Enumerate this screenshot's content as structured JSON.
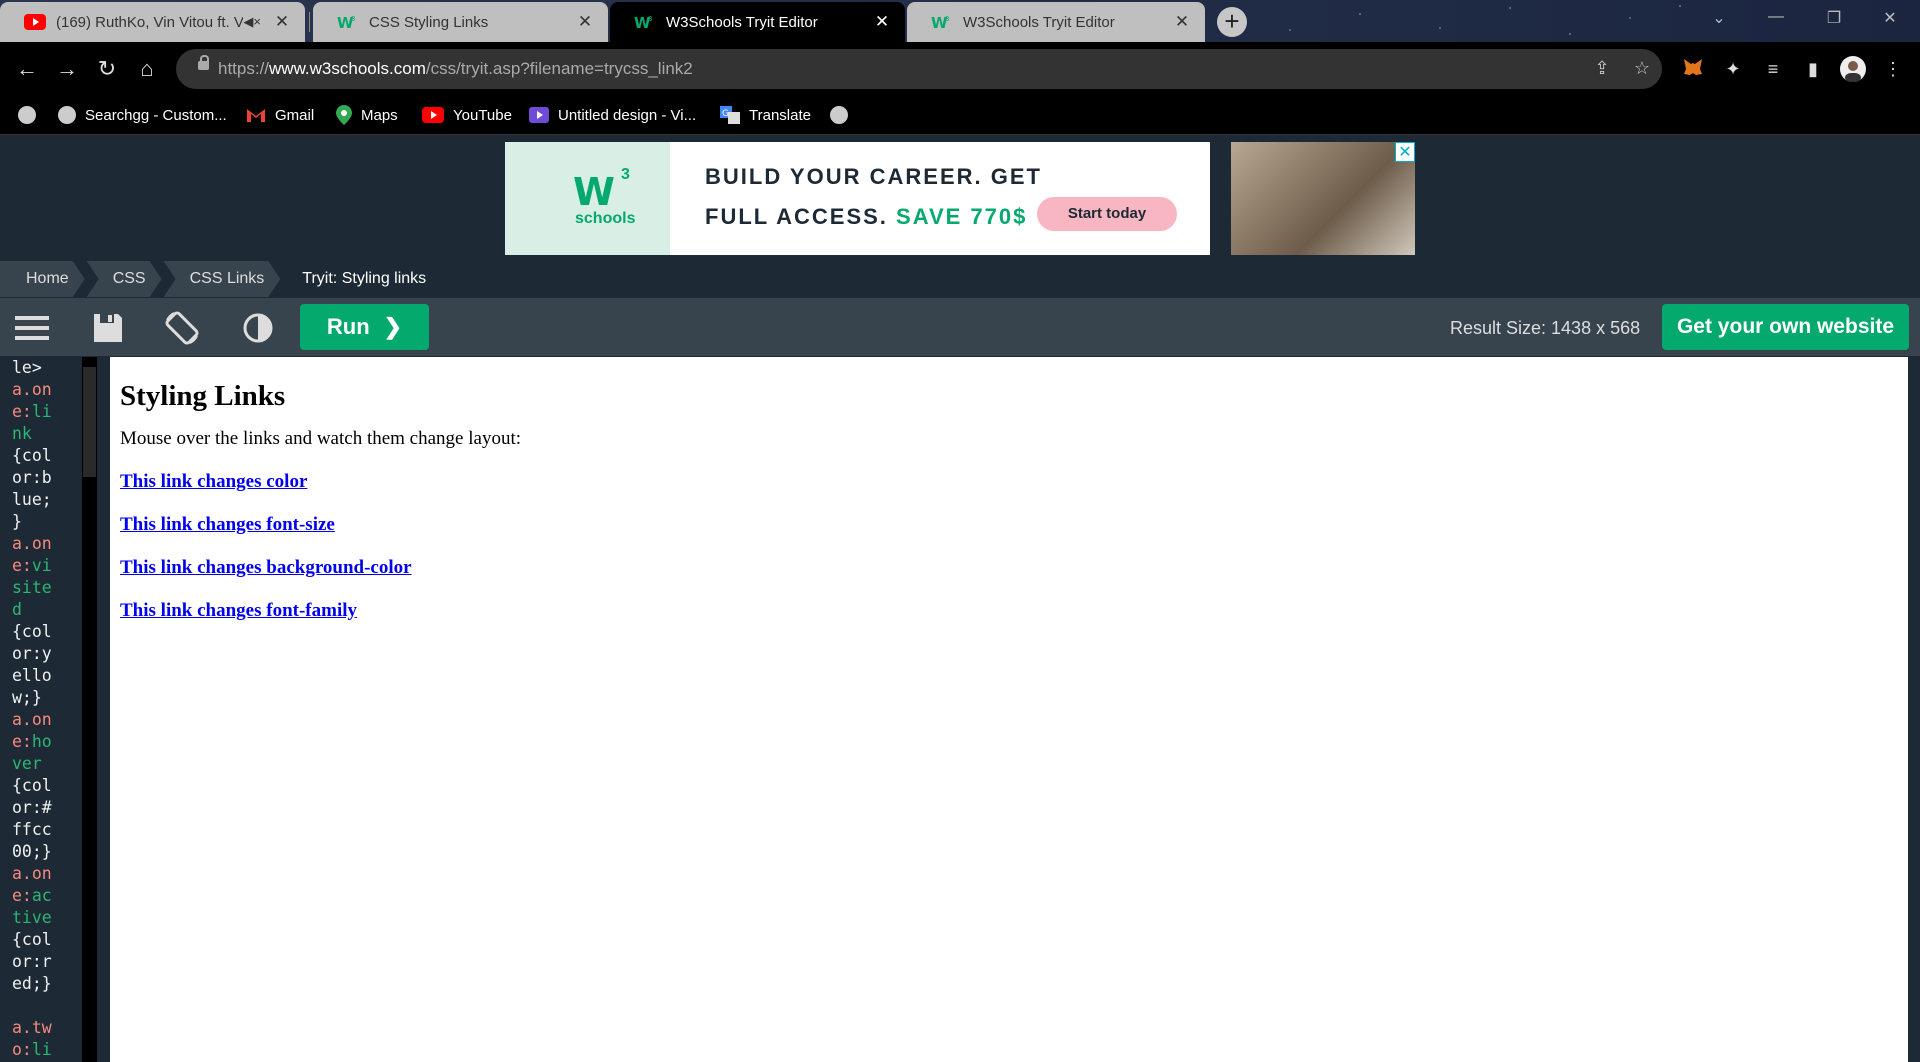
{
  "browser": {
    "tabs": [
      {
        "title": "(169) RuthKo, Vin Vitou ft. V",
        "favicon": "youtube-icon",
        "muted": true,
        "active": false
      },
      {
        "title": "CSS Styling Links",
        "favicon": "w3schools-icon",
        "active": false
      },
      {
        "title": "W3Schools Tryit Editor",
        "favicon": "w3schools-icon",
        "active": true
      },
      {
        "title": "W3Schools Tryit Editor",
        "favicon": "w3schools-icon",
        "active": false
      }
    ],
    "url_scheme": "https://",
    "url_host": "www.w3schools.com",
    "url_path": "/css/tryit.asp?filename=trycss_link2",
    "bookmarks": [
      "",
      "Searchgg - Custom...",
      "Gmail",
      "Maps",
      "YouTube",
      "Untitled design - Vi...",
      "Translate",
      ""
    ]
  },
  "ad": {
    "logo_text": "W",
    "logo_sup": "3",
    "logo_sub": "schools",
    "line1": "BUILD YOUR CAREER. GET",
    "line2_prefix": "FULL ACCESS.",
    "line2_highlight": "SAVE 770$",
    "cta": "Start today",
    "close": "✕"
  },
  "breadcrumb": [
    "Home",
    "CSS",
    "CSS Links",
    "Tryit: Styling links"
  ],
  "editor_toolbar": {
    "run_label": "Run",
    "result_size": "Result Size: 1438 x 568",
    "get_website": "Get your own website"
  },
  "code_lines": [
    {
      "t": "le>",
      "c": "c-val"
    },
    {
      "t": "a.on",
      "c": "c-sel"
    },
    {
      "t": "e:",
      "c": "c-sel",
      "p": "li"
    },
    {
      "t": "nk",
      "c": "c-pseudo"
    },
    {
      "t": "{col",
      "c": "c-val"
    },
    {
      "t": "or:b",
      "c": "c-val"
    },
    {
      "t": "lue;",
      "c": "c-val"
    },
    {
      "t": "}",
      "c": "c-val"
    },
    {
      "t": "a.on",
      "c": "c-sel"
    },
    {
      "t": "e:",
      "c": "c-sel",
      "p": "vi"
    },
    {
      "t": "site",
      "c": "c-pseudo"
    },
    {
      "t": "d",
      "c": "c-pseudo"
    },
    {
      "t": "{col",
      "c": "c-val"
    },
    {
      "t": "or:y",
      "c": "c-val"
    },
    {
      "t": "ello",
      "c": "c-val"
    },
    {
      "t": "w;}",
      "c": "c-val"
    },
    {
      "t": "a.on",
      "c": "c-sel"
    },
    {
      "t": "e:",
      "c": "c-sel",
      "p": "ho"
    },
    {
      "t": "ver",
      "c": "c-pseudo"
    },
    {
      "t": "{col",
      "c": "c-val"
    },
    {
      "t": "or:#",
      "c": "c-val"
    },
    {
      "t": "ffcc",
      "c": "c-val"
    },
    {
      "t": "00;}",
      "c": "c-val"
    },
    {
      "t": "a.on",
      "c": "c-sel"
    },
    {
      "t": "e:",
      "c": "c-sel",
      "p": "ac"
    },
    {
      "t": "tive",
      "c": "c-pseudo"
    },
    {
      "t": "{col",
      "c": "c-val"
    },
    {
      "t": "or:r",
      "c": "c-val"
    },
    {
      "t": "ed;}",
      "c": "c-val"
    },
    {
      "t": "",
      "c": "c-val"
    },
    {
      "t": "a.tw",
      "c": "c-sel"
    },
    {
      "t": "o:",
      "c": "c-sel",
      "p": "li"
    }
  ],
  "result": {
    "heading": "Styling Links",
    "intro": "Mouse over the links and watch them change layout:",
    "links": [
      "This link changes color",
      "This link changes font-size",
      "This link changes background-color",
      "This link changes font-family"
    ]
  },
  "colors": {
    "accent": "#04aa6d",
    "dark": "#1d2a35",
    "toolbar": "#38444d"
  }
}
